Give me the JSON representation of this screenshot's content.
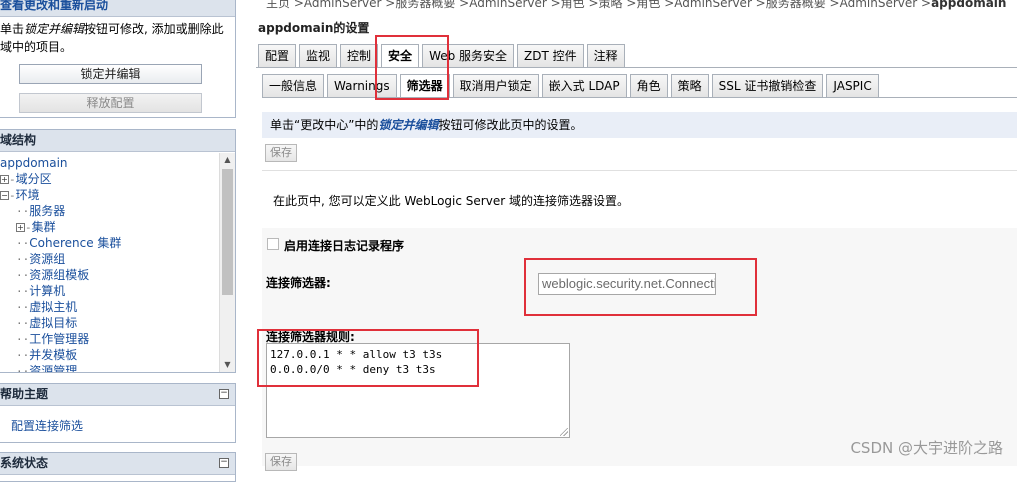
{
  "change_center": {
    "title": "查看更改和重新启动",
    "text_prefix": "单击",
    "text_emphasis": "锁定并编辑",
    "text_suffix": "按钮可修改, 添加或删除此",
    "text_line2": "域中的项目。",
    "lock_button": "锁定并编辑",
    "release_button": "释放配置"
  },
  "domain_structure": {
    "title": "域结构",
    "items": [
      {
        "label": "appdomain",
        "depth": 0,
        "toggle": "",
        "link": true
      },
      {
        "label": "域分区",
        "depth": 1,
        "toggle": "+",
        "link": true
      },
      {
        "label": "环境",
        "depth": 1,
        "toggle": "-",
        "link": true
      },
      {
        "label": "服务器",
        "depth": 2,
        "toggle": "",
        "link": true
      },
      {
        "label": "集群",
        "depth": 2,
        "toggle": "+",
        "link": true
      },
      {
        "label": "Coherence 集群",
        "depth": 2,
        "toggle": "",
        "link": true
      },
      {
        "label": "资源组",
        "depth": 2,
        "toggle": "",
        "link": true
      },
      {
        "label": "资源组模板",
        "depth": 2,
        "toggle": "",
        "link": true
      },
      {
        "label": "计算机",
        "depth": 2,
        "toggle": "",
        "link": true
      },
      {
        "label": "虚拟主机",
        "depth": 2,
        "toggle": "",
        "link": true
      },
      {
        "label": "虚拟目标",
        "depth": 2,
        "toggle": "",
        "link": true
      },
      {
        "label": "工作管理器",
        "depth": 2,
        "toggle": "",
        "link": true
      },
      {
        "label": "并发模板",
        "depth": 2,
        "toggle": "",
        "link": true
      },
      {
        "label": "资源管理",
        "depth": 2,
        "toggle": "",
        "link": true
      }
    ]
  },
  "help": {
    "title": "帮助主题",
    "link": "配置连接筛选"
  },
  "system_status": {
    "title": "系统状态"
  },
  "breadcrumb": {
    "text": "主页 >AdminServer >服务器概要 >AdminServer >角色 >策略 >角色 >AdminServer >服务器概要 >AdminServer >",
    "current": "appdomain"
  },
  "page_title": "appdomain的设置",
  "main_tabs": [
    {
      "label": "配置",
      "active": false
    },
    {
      "label": "监视",
      "active": false
    },
    {
      "label": "控制",
      "active": false
    },
    {
      "label": "安全",
      "active": true
    },
    {
      "label": "Web 服务安全",
      "active": false
    },
    {
      "label": "ZDT 控件",
      "active": false
    },
    {
      "label": "注释",
      "active": false
    }
  ],
  "sub_tabs": [
    {
      "label": "一般信息",
      "active": false
    },
    {
      "label": "Warnings",
      "active": false
    },
    {
      "label": "筛选器",
      "active": true
    },
    {
      "label": "取消用户锁定",
      "active": false
    },
    {
      "label": "嵌入式 LDAP",
      "active": false
    },
    {
      "label": "角色",
      "active": false
    },
    {
      "label": "策略",
      "active": false
    },
    {
      "label": "SSL 证书撤销检查",
      "active": false
    },
    {
      "label": "JASPIC",
      "active": false
    }
  ],
  "info": {
    "prefix": "单击“更改中心”中的",
    "emphasis": "锁定并编辑",
    "suffix": "按钮可修改此页中的设置。"
  },
  "save_label": "保存",
  "description": "在此页中, 您可以定义此 WebLogic Server 域的连接筛选器设置。",
  "enable_logging": {
    "label": "启用连接日志记录程序",
    "checked": false
  },
  "connection_filter": {
    "label": "连接筛选器:",
    "value": "weblogic.security.net.ConnectionFilterImpl"
  },
  "filter_rules": {
    "label": "连接筛选器规则:",
    "lines": [
      "127.0.0.1 * * allow t3 t3s",
      "0.0.0.0/0 * * deny t3 t3s"
    ]
  },
  "watermark": "CSDN @大宇进阶之路",
  "colors": {
    "link": "#1a4f9c",
    "highlight_box": "#e0303a",
    "info_bg": "#e9eef7"
  }
}
